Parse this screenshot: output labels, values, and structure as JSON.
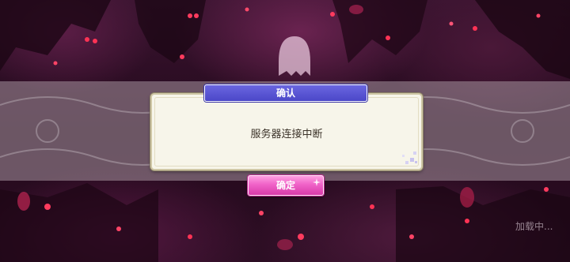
{
  "dialog": {
    "title": "确认",
    "message": "服务器连接中断",
    "confirm_label": "确定"
  },
  "status": {
    "loading_text": "加载中..."
  },
  "colors": {
    "title_bar": "#5551d6",
    "confirm_button": "#ea58c0",
    "dialog_bg": "#f7f5ea",
    "overlay_band": "#a8969f"
  }
}
